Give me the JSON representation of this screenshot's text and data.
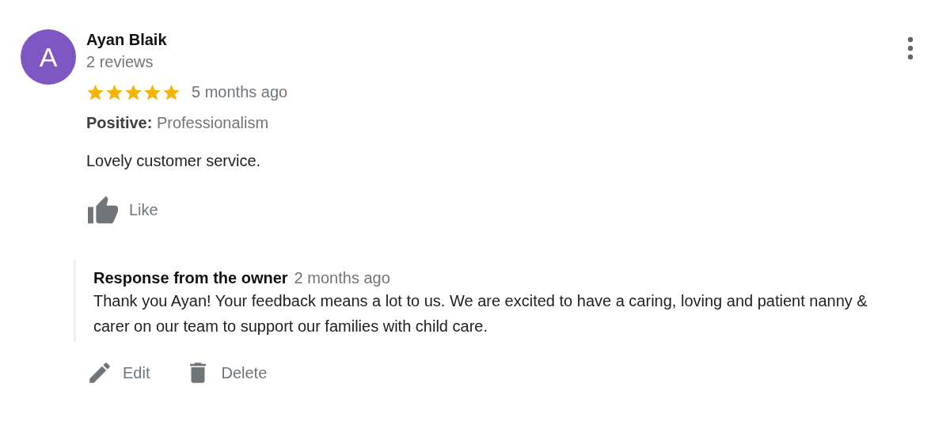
{
  "review": {
    "avatar_letter": "A",
    "author": "Ayan Blaik",
    "author_meta": "2 reviews",
    "stars": 5,
    "time": "5 months ago",
    "attributes": "**Positive:** Professionalism",
    "text": "Lovely customer service.",
    "like_label": "Like"
  },
  "owner_response": {
    "title": "Response from the owner",
    "time": "2 months ago",
    "text": "Thank you Ayan! Your feedback means a lot to us. We are excited to have a caring, loving and patient nanny & carer on our team to support our families with child care."
  },
  "actions": [
    {
      "kind": "edit",
      "label": "Edit"
    },
    {
      "kind": "delete",
      "label": "Delete"
    }
  ]
}
